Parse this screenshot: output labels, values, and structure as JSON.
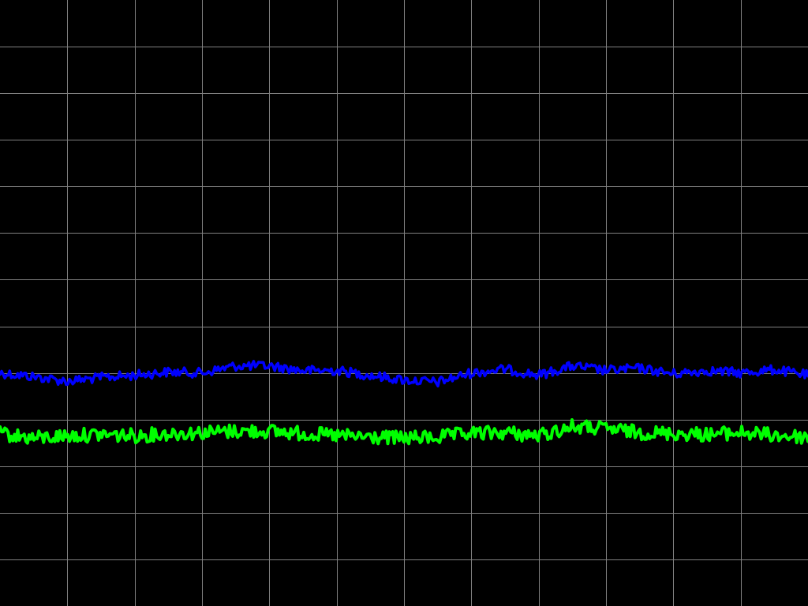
{
  "display": {
    "background_color": "#000000",
    "grid_color": "#808080",
    "grid_visible": true,
    "grid_divisions": {
      "horizontal": 12,
      "vertical": 13
    }
  },
  "chart_data": {
    "type": "line",
    "title": "",
    "xlabel": "",
    "ylabel": "",
    "xlim": [
      0,
      12
    ],
    "ylim": [
      -6.5,
      6.5
    ],
    "grid": true,
    "legend": "none",
    "series": [
      {
        "color": "#0000ff",
        "x": [
          0.0,
          0.5,
          1.0,
          1.5,
          2.0,
          2.5,
          3.0,
          3.5,
          4.0,
          4.5,
          5.0,
          5.5,
          6.0,
          6.5,
          7.0,
          7.5,
          8.0,
          8.5,
          9.0,
          9.5,
          10.0,
          10.5,
          11.0,
          11.5,
          12.0
        ],
        "y": [
          -1.5,
          -1.58,
          -1.68,
          -1.6,
          -1.55,
          -1.48,
          -1.5,
          -1.35,
          -1.35,
          -1.45,
          -1.45,
          -1.55,
          -1.65,
          -1.7,
          -1.5,
          -1.42,
          -1.55,
          -1.35,
          -1.45,
          -1.4,
          -1.52,
          -1.45,
          -1.5,
          -1.43,
          -1.55
        ]
      },
      {
        "color": "#00ff00",
        "x": [
          0.0,
          0.5,
          1.0,
          1.5,
          2.0,
          2.5,
          3.0,
          3.5,
          4.0,
          4.5,
          5.0,
          5.5,
          6.0,
          6.5,
          7.0,
          7.5,
          8.0,
          8.5,
          9.0,
          9.5,
          10.0,
          10.5,
          11.0,
          11.5,
          12.0
        ],
        "y": [
          -2.8,
          -2.9,
          -2.85,
          -2.82,
          -2.85,
          -2.8,
          -2.78,
          -2.75,
          -2.75,
          -2.8,
          -2.85,
          -2.88,
          -2.9,
          -2.88,
          -2.8,
          -2.78,
          -2.85,
          -2.65,
          -2.7,
          -2.78,
          -2.8,
          -2.82,
          -2.78,
          -2.84,
          -2.88
        ]
      }
    ]
  }
}
